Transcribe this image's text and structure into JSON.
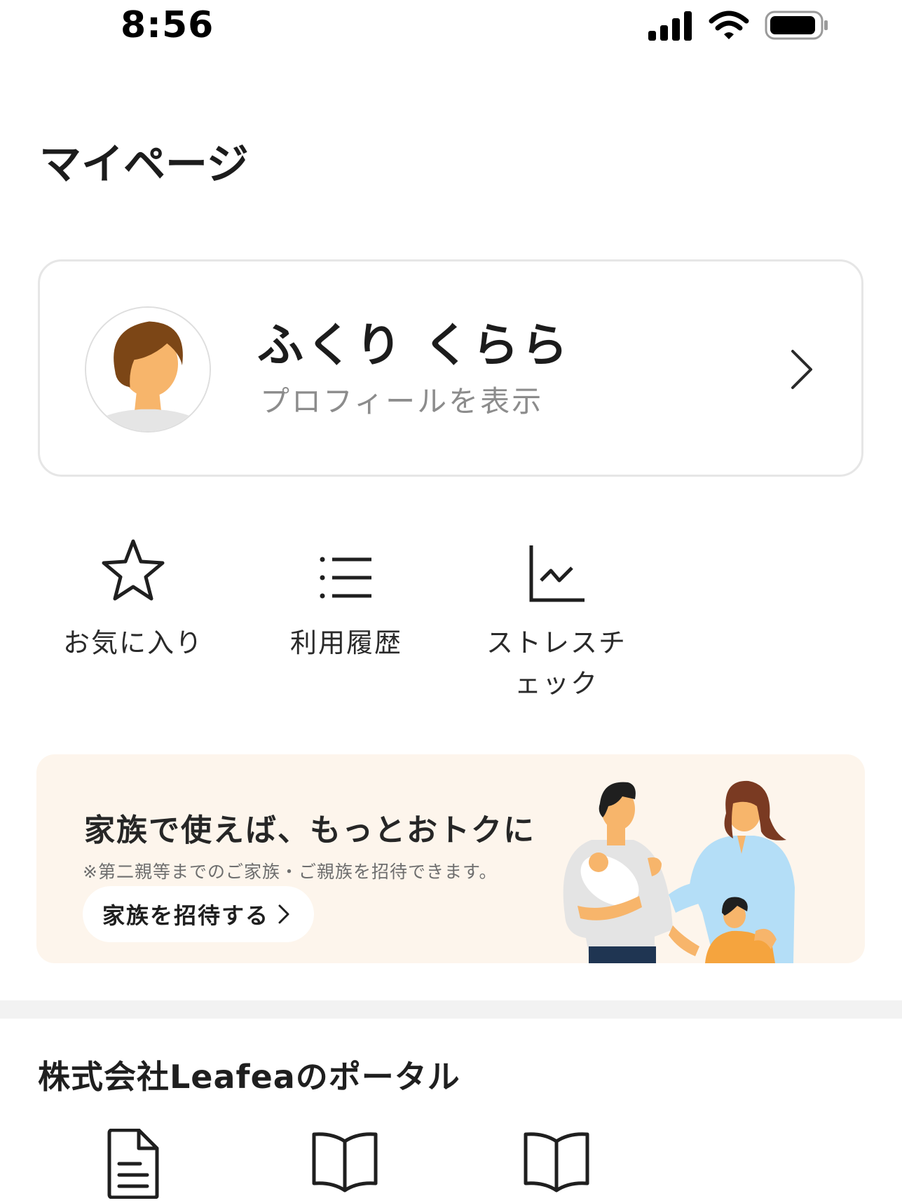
{
  "status_bar": {
    "time": "8:56"
  },
  "page": {
    "title": "マイページ"
  },
  "profile": {
    "name": "ふくり くらら",
    "link_label": "プロフィールを表示"
  },
  "shortcuts": [
    {
      "label": "お気に入り",
      "icon": "star-icon"
    },
    {
      "label": "利用履歴",
      "icon": "list-icon"
    },
    {
      "label": "ストレスチェック",
      "icon": "chart-icon"
    }
  ],
  "family_banner": {
    "title": "家族で使えば、もっとおトクに",
    "note": "※第二親等までのご家族・ご親族を招待できます。",
    "button_label": "家族を招待する"
  },
  "portal": {
    "title": "株式会社Leafeaのポータル",
    "icons": [
      "document-icon",
      "book-icon",
      "book-icon"
    ]
  },
  "colors": {
    "banner_bg": "#fdf5ec",
    "text_primary": "#1c1c1c",
    "text_secondary": "#8c8c8c"
  }
}
